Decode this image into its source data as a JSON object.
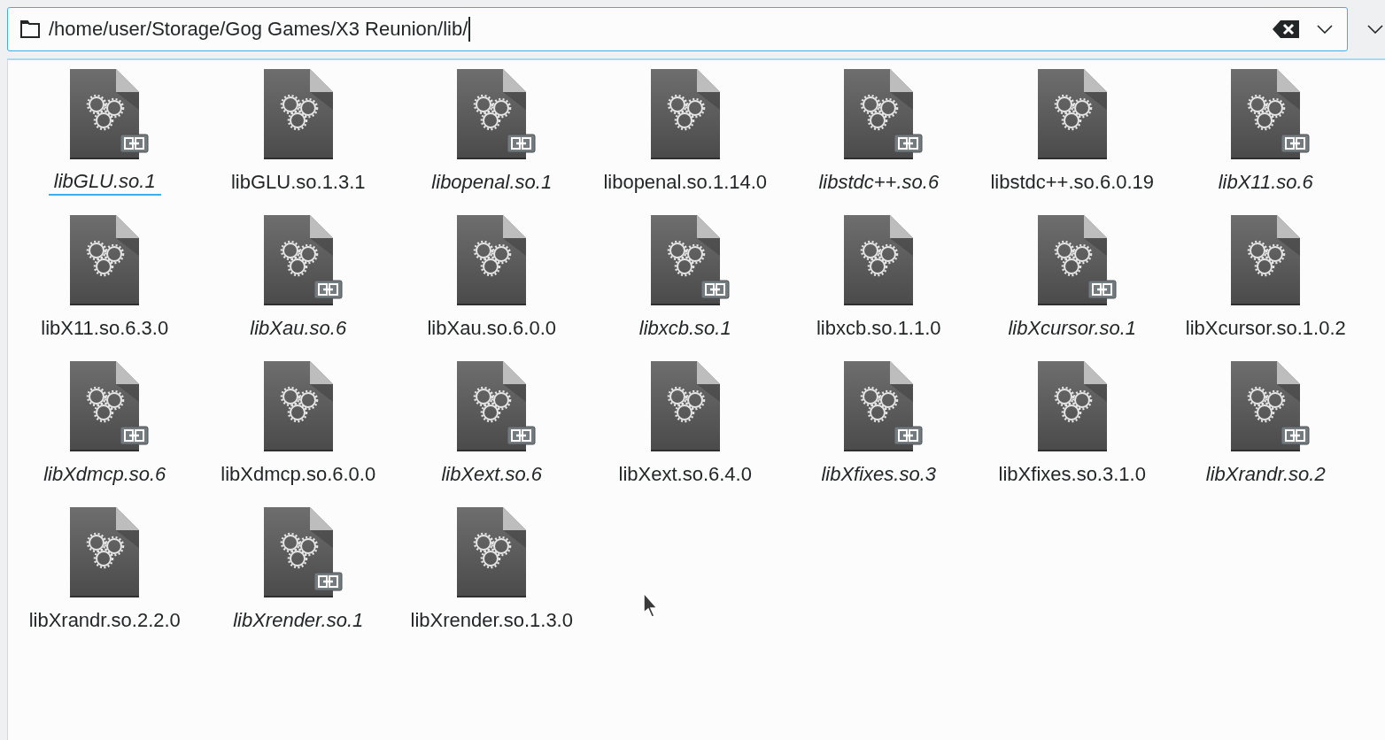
{
  "location": {
    "path": "/home/user/Storage/Gog Games/X3 Reunion/lib/"
  },
  "files": [
    {
      "name": "libGLU.so.1",
      "symlink": true,
      "focused": true
    },
    {
      "name": "libGLU.so.1.3.1",
      "symlink": false,
      "focused": false
    },
    {
      "name": "libopenal.so.1",
      "symlink": true,
      "focused": false
    },
    {
      "name": "libopenal.so.1.14.0",
      "symlink": false,
      "focused": false
    },
    {
      "name": "libstdc++.so.6",
      "symlink": true,
      "focused": false
    },
    {
      "name": "libstdc++.so.6.0.19",
      "symlink": false,
      "focused": false
    },
    {
      "name": "libX11.so.6",
      "symlink": true,
      "focused": false
    },
    {
      "name": "libX11.so.6.3.0",
      "symlink": false,
      "focused": false
    },
    {
      "name": "libXau.so.6",
      "symlink": true,
      "focused": false
    },
    {
      "name": "libXau.so.6.0.0",
      "symlink": false,
      "focused": false
    },
    {
      "name": "libxcb.so.1",
      "symlink": true,
      "focused": false
    },
    {
      "name": "libxcb.so.1.1.0",
      "symlink": false,
      "focused": false
    },
    {
      "name": "libXcursor.so.1",
      "symlink": true,
      "focused": false
    },
    {
      "name": "libXcursor.so.1.0.2",
      "symlink": false,
      "focused": false
    },
    {
      "name": "libXdmcp.so.6",
      "symlink": true,
      "focused": false
    },
    {
      "name": "libXdmcp.so.6.0.0",
      "symlink": false,
      "focused": false
    },
    {
      "name": "libXext.so.6",
      "symlink": true,
      "focused": false
    },
    {
      "name": "libXext.so.6.4.0",
      "symlink": false,
      "focused": false
    },
    {
      "name": "libXfixes.so.3",
      "symlink": true,
      "focused": false
    },
    {
      "name": "libXfixes.so.3.1.0",
      "symlink": false,
      "focused": false
    },
    {
      "name": "libXrandr.so.2",
      "symlink": true,
      "focused": false
    },
    {
      "name": "libXrandr.so.2.2.0",
      "symlink": false,
      "focused": false
    },
    {
      "name": "libXrender.so.1",
      "symlink": true,
      "focused": false
    },
    {
      "name": "libXrender.so.1.3.0",
      "symlink": false,
      "focused": false
    }
  ]
}
